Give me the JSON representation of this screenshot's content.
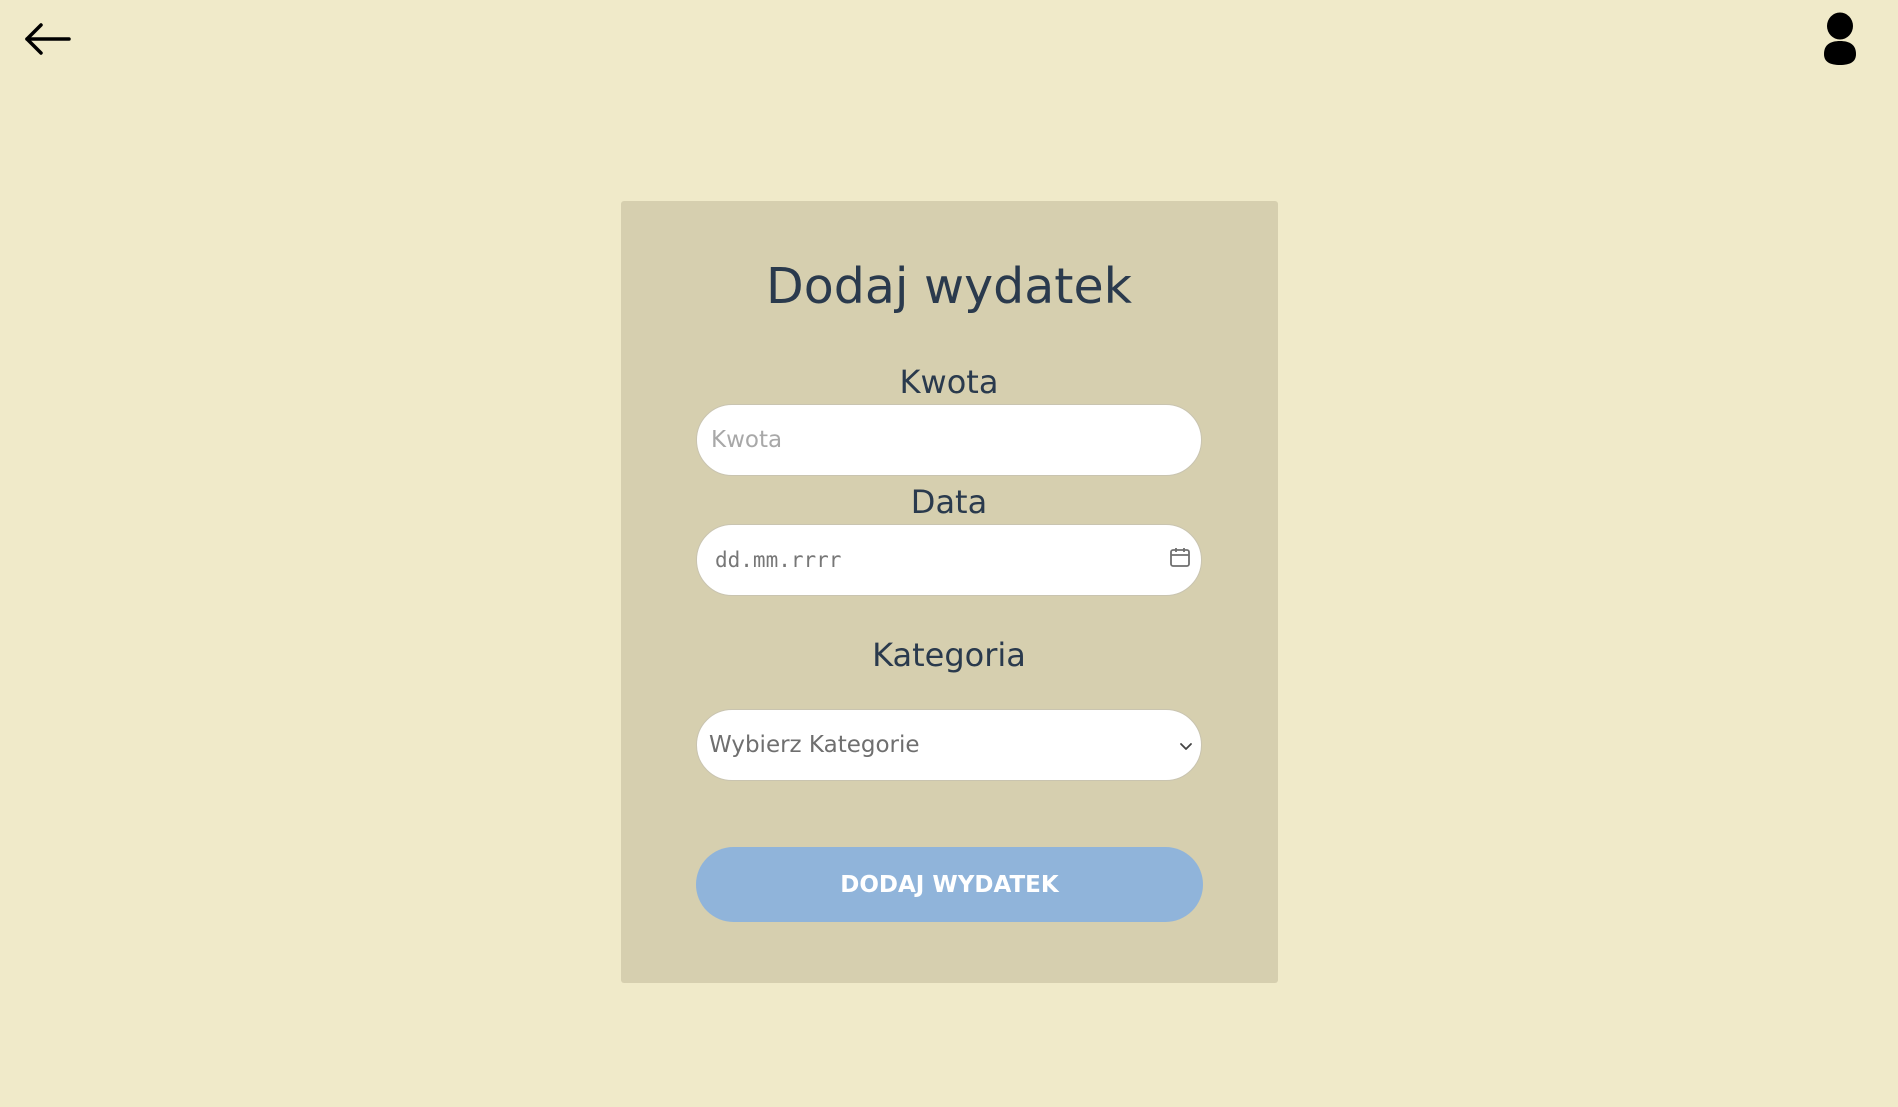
{
  "header": {
    "back_icon": "arrow-left-icon",
    "user_icon": "user-icon"
  },
  "form": {
    "title": "Dodaj wydatek",
    "amount_label": "Kwota",
    "amount_placeholder": "Kwota",
    "date_label": "Data",
    "date_placeholder": "dd.mm.rrrr",
    "date_icon": "calendar-icon",
    "category_label": "Kategoria",
    "category_selected": "Wybierz Kategorie",
    "category_icon": "chevron-down-icon",
    "submit_label": "DODAJ WYDATEK"
  },
  "colors": {
    "background": "#f0eac9",
    "card": "#d6cfaf",
    "text": "#2a3a4d",
    "button": "#90b4da"
  }
}
